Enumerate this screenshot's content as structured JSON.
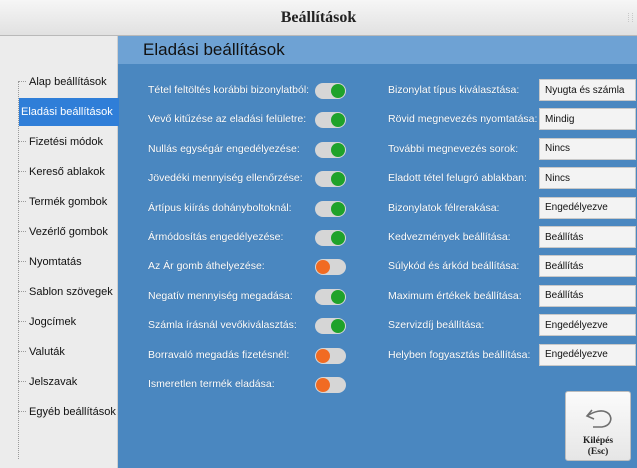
{
  "window": {
    "title": "Beállítások"
  },
  "sidebar": {
    "items": [
      {
        "label": "Alap beállítások",
        "active": false
      },
      {
        "label": "Eladási beállítások",
        "active": true
      },
      {
        "label": "Fizetési módok",
        "active": false
      },
      {
        "label": "Kereső ablakok",
        "active": false
      },
      {
        "label": "Termék gombok",
        "active": false
      },
      {
        "label": "Vezérlő gombok",
        "active": false
      },
      {
        "label": "Nyomtatás",
        "active": false
      },
      {
        "label": "Sablon szövegek",
        "active": false
      },
      {
        "label": "Jogcímek",
        "active": false
      },
      {
        "label": "Valuták",
        "active": false
      },
      {
        "label": "Jelszavak",
        "active": false
      },
      {
        "label": "Egyéb beállítások",
        "active": false
      }
    ]
  },
  "panel": {
    "title": "Eladási beállítások"
  },
  "toggles": [
    {
      "label": "Tétel feltöltés korábbi bizonylatból:",
      "on": true
    },
    {
      "label": "Vevő kitűzése az eladási felületre:",
      "on": true
    },
    {
      "label": "Nullás egységár engedélyezése:",
      "on": true
    },
    {
      "label": "Jövedéki mennyiség ellenőrzése:",
      "on": true
    },
    {
      "label": "Ártípus kiírás dohányboltoknál:",
      "on": true
    },
    {
      "label": "Ármódosítás engedélyezése:",
      "on": true
    },
    {
      "label": "Az Ár gomb áthelyezése:",
      "on": false
    },
    {
      "label": "Negatív mennyiség megadása:",
      "on": true
    },
    {
      "label": "Számla írásnál vevőkiválasztás:",
      "on": true
    },
    {
      "label": "Borravaló megadás fizetésnél:",
      "on": false
    },
    {
      "label": "Ismeretlen termék eladása:",
      "on": false
    }
  ],
  "settings": [
    {
      "label": "Bizonylat típus kiválasztása:",
      "value": "Nyugta és számla"
    },
    {
      "label": "Rövid megnevezés nyomtatása:",
      "value": "Mindig"
    },
    {
      "label": "További megnevezés sorok:",
      "value": "Nincs"
    },
    {
      "label": "Eladott tétel felugró ablakban:",
      "value": "Nincs"
    },
    {
      "label": "Bizonylatok félrerakása:",
      "value": "Engedélyezve"
    },
    {
      "label": "Kedvezmények beállítása:",
      "value": "Beállítás"
    },
    {
      "label": "Súlykód és árkód beállítása:",
      "value": "Beállítás"
    },
    {
      "label": "Maximum értékek beállítása:",
      "value": "Beállítás"
    },
    {
      "label": "Szervizdíj beállítása:",
      "value": "Engedélyezve"
    },
    {
      "label": "Helyben fogyasztás beállítása:",
      "value": "Engedélyezve"
    }
  ],
  "exit_button": {
    "label_line1": "Kilépés",
    "label_line2": "(Esc)",
    "icon": "undo-arrow-icon"
  },
  "colors": {
    "background": "#4a87c0",
    "toggle_on": "#1fa22a",
    "toggle_off": "#f16b22",
    "sidebar_active": "#2f7ed8"
  }
}
